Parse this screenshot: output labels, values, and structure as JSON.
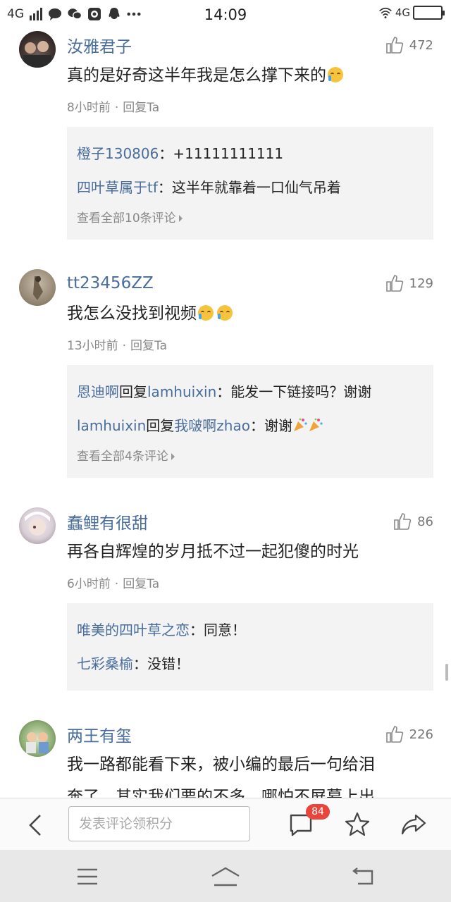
{
  "status_bar": {
    "network_left": "4G",
    "time": "14:09",
    "network_right": "4G"
  },
  "comments": [
    {
      "username": "汝雅君子",
      "likes": "472",
      "text": "真的是好奇这半年我是怎么撑下来的",
      "time": "8小时前",
      "reply_label": "回复Ta",
      "replies": [
        {
          "name": "橙子130806",
          "text": "：+11111111111"
        },
        {
          "name": "四叶草属于tf",
          "text": "：这半年就靠着一口仙气吊着"
        }
      ],
      "more": "查看全部10条评论"
    },
    {
      "username": "tt23456ZZ",
      "likes": "129",
      "text": "我怎么没找到视频",
      "time": "13小时前",
      "reply_label": "回复Ta",
      "replies": [
        {
          "name": "恩迪啊",
          "mid": "回复",
          "name2": "lamhuixin",
          "text": "：能发一下链接吗？谢谢"
        },
        {
          "name": "lamhuixin",
          "mid": "回复",
          "name2": "我啵啊zhao",
          "text": "：谢谢"
        }
      ],
      "more": "查看全部4条评论"
    },
    {
      "username": "蠢鲤有很甜",
      "likes": "86",
      "text": "再各自辉煌的岁月抵不过一起犯傻的时光",
      "time": "6小时前",
      "reply_label": "回复Ta",
      "replies": [
        {
          "name": "唯美的四叶草之恋",
          "text": "：同意！"
        },
        {
          "name": "七彩桑榆",
          "text": "：没错！"
        }
      ]
    },
    {
      "username": "两王有玺",
      "likes": "226",
      "text_line1": "我一路都能看下来，被小编的最后一句给泪",
      "text_line2": "奔了，其实我们要的不多，哪怕不屏幕上出"
    }
  ],
  "action_bar": {
    "input_placeholder": "发表评论领积分",
    "comment_count": "84"
  }
}
